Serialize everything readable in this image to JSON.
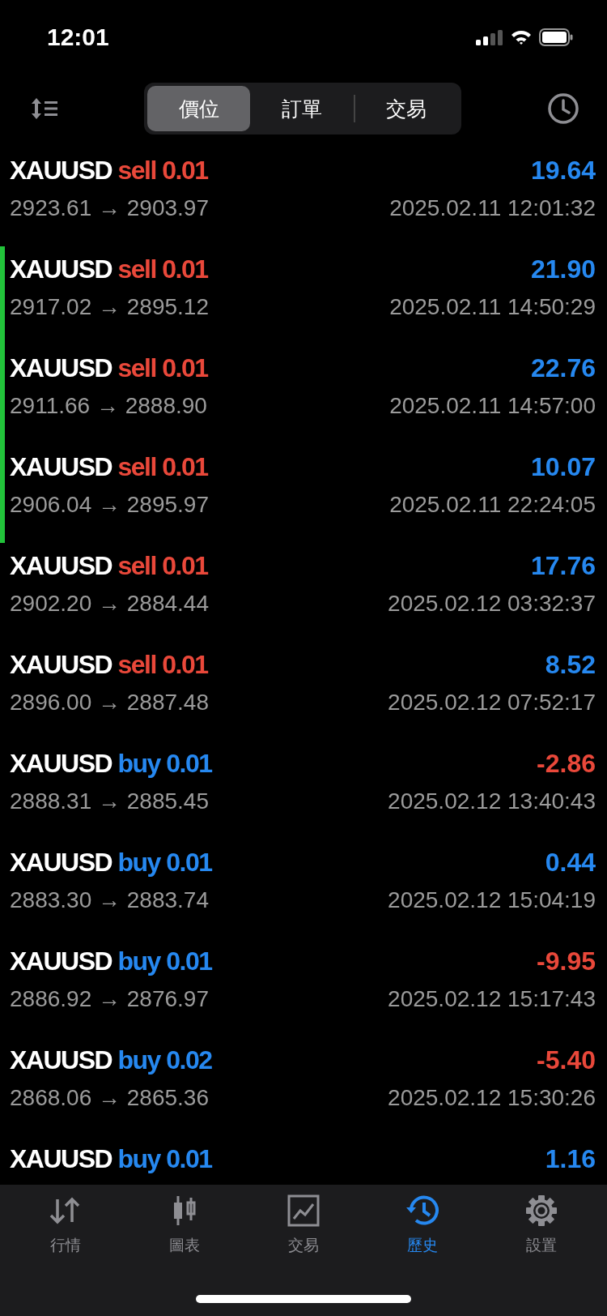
{
  "status_bar": {
    "time": "12:01"
  },
  "segments": [
    {
      "label": "價位",
      "selected": true
    },
    {
      "label": "訂單",
      "selected": false
    },
    {
      "label": "交易",
      "selected": false
    }
  ],
  "deals": [
    {
      "symbol": "XAUUSD",
      "side": "sell",
      "kind": "sell",
      "volume": "0.01",
      "profit": "19.64",
      "color": "#2688f0",
      "highlighted": false,
      "prices": "2923.61 → 2903.97",
      "time": "2025.02.11 12:01:32"
    },
    {
      "symbol": "XAUUSD",
      "side": "sell",
      "kind": "sell",
      "volume": "0.01",
      "profit": "21.90",
      "color": "#2688f0",
      "highlighted": true,
      "prices": "2917.02 → 2895.12",
      "time": "2025.02.11 14:50:29"
    },
    {
      "symbol": "XAUUSD",
      "side": "sell",
      "kind": "sell",
      "volume": "0.01",
      "profit": "22.76",
      "color": "#2688f0",
      "highlighted": true,
      "prices": "2911.66 → 2888.90",
      "time": "2025.02.11 14:57:00"
    },
    {
      "symbol": "XAUUSD",
      "side": "sell",
      "kind": "sell",
      "volume": "0.01",
      "profit": "10.07",
      "color": "#2688f0",
      "highlighted": true,
      "prices": "2906.04 → 2895.97",
      "time": "2025.02.11 22:24:05"
    },
    {
      "symbol": "XAUUSD",
      "side": "sell",
      "kind": "sell",
      "volume": "0.01",
      "profit": "17.76",
      "color": "#2688f0",
      "highlighted": false,
      "prices": "2902.20 → 2884.44",
      "time": "2025.02.12 03:32:37"
    },
    {
      "symbol": "XAUUSD",
      "side": "sell",
      "kind": "sell",
      "volume": "0.01",
      "profit": "8.52",
      "color": "#2688f0",
      "highlighted": false,
      "prices": "2896.00 → 2887.48",
      "time": "2025.02.12 07:52:17"
    },
    {
      "symbol": "XAUUSD",
      "side": "buy",
      "kind": "buy",
      "volume": "0.01",
      "profit": "-2.86",
      "color": "#e9483a",
      "highlighted": false,
      "prices": "2888.31 → 2885.45",
      "time": "2025.02.12 13:40:43"
    },
    {
      "symbol": "XAUUSD",
      "side": "buy",
      "kind": "buy",
      "volume": "0.01",
      "profit": "0.44",
      "color": "#2688f0",
      "highlighted": false,
      "prices": "2883.30 → 2883.74",
      "time": "2025.02.12 15:04:19"
    },
    {
      "symbol": "XAUUSD",
      "side": "buy",
      "kind": "buy",
      "volume": "0.01",
      "profit": "-9.95",
      "color": "#e9483a",
      "highlighted": false,
      "prices": "2886.92 → 2876.97",
      "time": "2025.02.12 15:17:43"
    },
    {
      "symbol": "XAUUSD",
      "side": "buy",
      "kind": "buy",
      "volume": "0.02",
      "profit": "-5.40",
      "color": "#e9483a",
      "highlighted": false,
      "prices": "2868.06 → 2865.36",
      "time": "2025.02.12 15:30:26"
    },
    {
      "symbol": "XAUUSD",
      "side": "buy",
      "kind": "buy",
      "volume": "0.01",
      "profit": "1.16",
      "color": "#2688f0",
      "highlighted": false
    }
  ],
  "tab_bar": [
    {
      "label": "行情",
      "kind": "quotes",
      "selected": false
    },
    {
      "label": "圖表",
      "kind": "chart",
      "selected": false
    },
    {
      "label": "交易",
      "kind": "trade",
      "selected": false
    },
    {
      "label": "歷史",
      "kind": "history",
      "selected": true
    },
    {
      "label": "設置",
      "kind": "settings",
      "selected": false
    }
  ]
}
